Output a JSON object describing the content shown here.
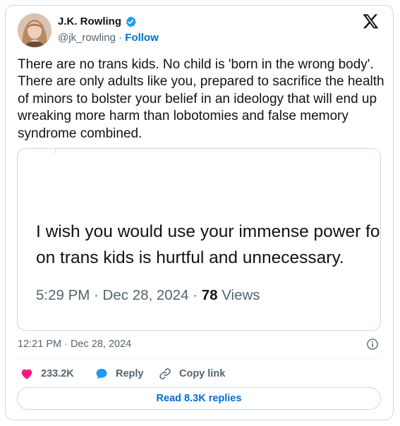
{
  "author": {
    "name": "J.K. Rowling",
    "handle": "@jk_rowling",
    "separator": "·",
    "follow_label": "Follow"
  },
  "tweet": {
    "text": "There are no trans kids. No child is 'born in the wrong body'. There are only adults like you, prepared to sacrifice the health of minors to bolster your belief in an ideology that will end up wreaking more harm than lobotomies and false memory syndrome combined."
  },
  "quoted_image": {
    "line1": "I wish you would use your immense power fo",
    "line2": "on trans kids is hurtful and unnecessary.",
    "meta_time": "5:29 PM · Dec 28, 2024 · ",
    "meta_views_count": "78",
    "meta_views_label": " Views"
  },
  "timestamp": "12:21 PM · Dec 28, 2024",
  "actions": {
    "like_count": "233.2K",
    "reply_label": "Reply",
    "copy_label": "Copy link"
  },
  "read_replies_label": "Read 8.3K replies",
  "colors": {
    "like": "#f91880",
    "reply": "#1d9bf0",
    "link": "#006fd6",
    "verified": "#1d9bf0"
  },
  "icons": [
    "verified-badge-icon",
    "x-logo-icon",
    "info-icon",
    "heart-icon",
    "reply-bubble-icon",
    "link-icon"
  ]
}
